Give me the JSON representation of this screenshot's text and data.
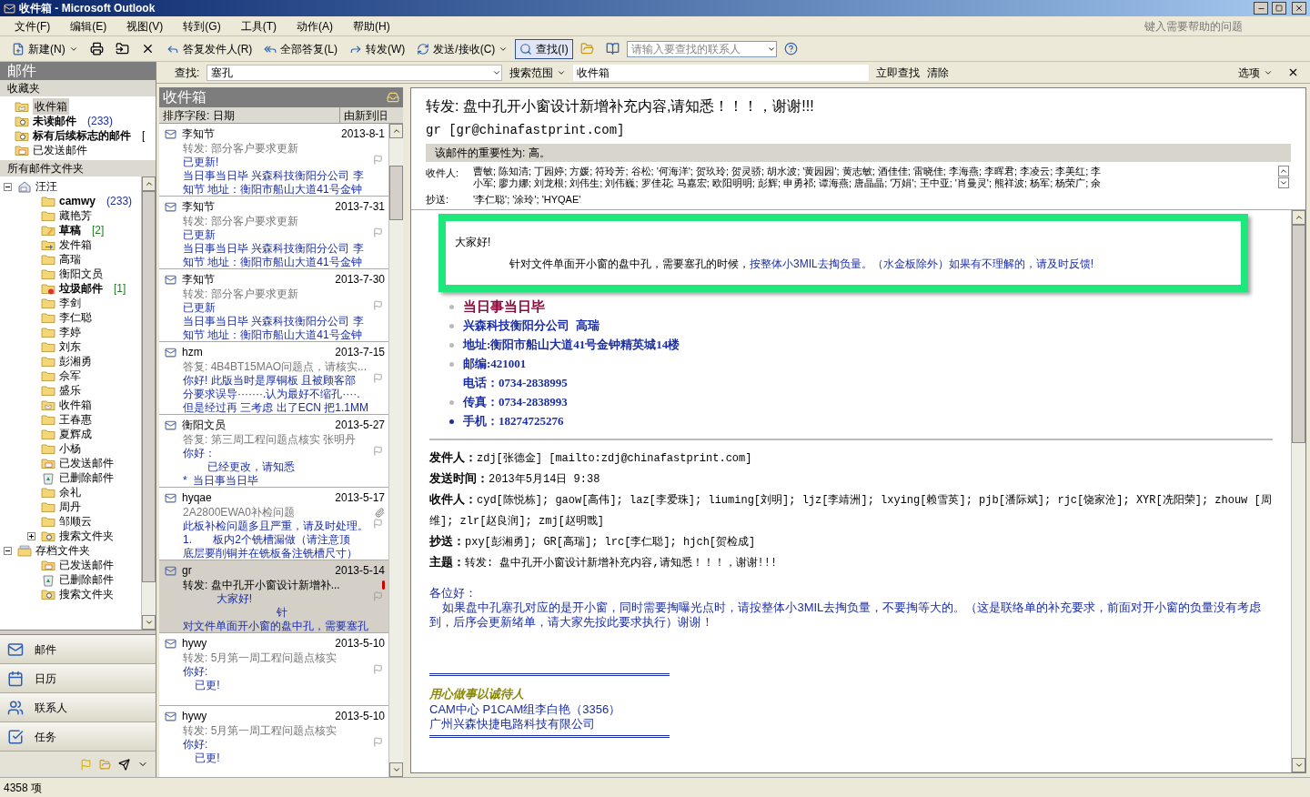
{
  "window": {
    "title": "收件箱 - Microsoft Outlook"
  },
  "menu": [
    "文件(F)",
    "编辑(E)",
    "视图(V)",
    "转到(G)",
    "工具(T)",
    "动作(A)",
    "帮助(H)"
  ],
  "help_box": {
    "placeholder": "键入需要帮助的问题"
  },
  "toolbar": [
    {
      "label": "新建(N)",
      "selected": false
    },
    {
      "label": "答复发件人(R)",
      "selected": false
    },
    {
      "label": "全部答复(L)",
      "selected": false
    },
    {
      "label": "转发(W)",
      "selected": false
    },
    {
      "label": "发送/接收(C)",
      "selected": false
    },
    {
      "label": "查找(I)",
      "selected": true
    }
  ],
  "contact_search": {
    "placeholder": "请输入要查找的联系人"
  },
  "navigation_title": "邮件",
  "find_bar": {
    "label": "查找:",
    "value": "塞孔",
    "scope_button": "搜索范围",
    "scope_value": "收件箱",
    "find_now": "立即查找",
    "clear": "清除",
    "options": "选项"
  },
  "favorites": {
    "title": "收藏夹",
    "items": [
      {
        "name": "收件箱",
        "kind": "inbox",
        "bold": false,
        "selected": true
      },
      {
        "name": "未读邮件",
        "kind": "search",
        "bold": true,
        "count": "(233)",
        "color": "#1b2ea6",
        "selected": false
      },
      {
        "name": "标有后续标志的邮件",
        "kind": "search",
        "bold": true,
        "count": "[",
        "selected": false
      },
      {
        "name": "已发送邮件",
        "kind": "sent",
        "bold": false,
        "selected": false
      }
    ]
  },
  "all_folders": {
    "title": "所有邮件文件夹",
    "tree": [
      {
        "name": "汪汪",
        "kind": "home",
        "bold": false,
        "expanded": true,
        "children": [
          {
            "name": "camwy",
            "kind": "folder",
            "bold": true,
            "count": "(233)",
            "color": "#1b2ea6"
          },
          {
            "name": "藏艳芳",
            "kind": "folder",
            "bold": false
          },
          {
            "name": "草稿",
            "kind": "drafts",
            "bold": true,
            "count": "[2]",
            "color": "#1d7a1d"
          },
          {
            "name": "发件箱",
            "kind": "outbox",
            "bold": false
          },
          {
            "name": "高瑞",
            "kind": "folder",
            "bold": false
          },
          {
            "name": "衡阳文员",
            "kind": "folder",
            "bold": false
          },
          {
            "name": "垃圾邮件",
            "kind": "junk",
            "bold": true,
            "count": "[1]",
            "color": "#1d7a1d"
          },
          {
            "name": "李剑",
            "kind": "folder",
            "bold": false
          },
          {
            "name": "李仁聪",
            "kind": "folder",
            "bold": false
          },
          {
            "name": "李婷",
            "kind": "folder",
            "bold": false
          },
          {
            "name": "刘东",
            "kind": "folder",
            "bold": false
          },
          {
            "name": "彭湘勇",
            "kind": "folder",
            "bold": false
          },
          {
            "name": "佘军",
            "kind": "folder",
            "bold": false
          },
          {
            "name": "盛乐",
            "kind": "folder",
            "bold": false
          },
          {
            "name": "收件箱",
            "kind": "inbox",
            "bold": false
          },
          {
            "name": "王春惠",
            "kind": "folder",
            "bold": false
          },
          {
            "name": "夏辉成",
            "kind": "folder",
            "bold": false
          },
          {
            "name": "小杨",
            "kind": "folder",
            "bold": false
          },
          {
            "name": "已发送邮件",
            "kind": "sent",
            "bold": false
          },
          {
            "name": "已删除邮件",
            "kind": "deleted",
            "bold": false
          },
          {
            "name": "余礼",
            "kind": "folder",
            "bold": false
          },
          {
            "name": "周丹",
            "kind": "folder",
            "bold": false
          },
          {
            "name": "邹顺云",
            "kind": "folder",
            "bold": false
          },
          {
            "name": "搜索文件夹",
            "kind": "search",
            "bold": false,
            "expanded": false
          }
        ]
      },
      {
        "name": "存档文件夹",
        "kind": "archive",
        "bold": false,
        "expanded": true,
        "children": [
          {
            "name": "已发送邮件",
            "kind": "sent",
            "bold": false
          },
          {
            "name": "已删除邮件",
            "kind": "deleted",
            "bold": false
          },
          {
            "name": "搜索文件夹",
            "kind": "search",
            "bold": false
          }
        ]
      }
    ]
  },
  "nav_buttons": [
    "邮件",
    "日历",
    "联系人",
    "任务"
  ],
  "message_list": {
    "title": "收件箱",
    "sort_label": "排序字段: 日期",
    "sort_order": "由新到旧",
    "messages": [
      {
        "sender": "李知节",
        "date": "2013-8-1",
        "subject": "转发: 部分客户要求更新",
        "preview": [
          "已更新!",
          "当日事当日毕 兴森科技衡阳分公司 李",
          "知节 地址：衡阳市船山大道41号金钟"
        ],
        "selected": false,
        "attachment": false,
        "important": false
      },
      {
        "sender": "李知节",
        "date": "2013-7-31",
        "subject": "转发: 部分客户要求更新",
        "preview": [
          "已更新",
          "当日事当日毕 兴森科技衡阳分公司 李",
          "知节 地址：衡阳市船山大道41号金钟"
        ],
        "selected": false,
        "attachment": false,
        "important": false
      },
      {
        "sender": "李知节",
        "date": "2013-7-30",
        "subject": "转发: 部分客户要求更新",
        "preview": [
          "已更新",
          "当日事当日毕 兴森科技衡阳分公司 李",
          "知节 地址：衡阳市船山大道41号金钟"
        ],
        "selected": false,
        "attachment": false,
        "important": false
      },
      {
        "sender": "hzm",
        "date": "2013-7-15",
        "subject": "答复: 4B4BT15MAO问题点，请核实...",
        "preview": [
          "你好! 此版当时是厚铜板 且被顾客部",
          "分要求误导·······.认为最好不缩孔····.",
          "但是经过再 三考虑 出了ECN 把1.1MM"
        ],
        "selected": false,
        "attachment": false,
        "important": false
      },
      {
        "sender": "衡阳文员",
        "date": "2013-5-27",
        "subject": "答复: 第三周工程问题点核实 张明丹",
        "preview": [
          "你好：",
          "        已经更改，请知悉",
          "*  当日事当日毕"
        ],
        "selected": false,
        "attachment": false,
        "important": false
      },
      {
        "sender": "hyqae",
        "date": "2013-5-17",
        "subject": "2A2800EWA0补检问题",
        "preview": [
          "此板补检问题多且严重，请及时处理。",
          "1.       板内2个铣槽漏做（请注意顶",
          "底层要削铜并在铣板备注铣槽尺寸）"
        ],
        "selected": false,
        "attachment": true,
        "important": false
      },
      {
        "sender": "gr",
        "date": "2013-5-14",
        "subject": "转发: 盘中孔开小窗设计新增补...",
        "preview": [
          "           大家好!",
          "                               针",
          "对文件单面开小窗的盘中孔，需要塞孔"
        ],
        "selected": true,
        "attachment": false,
        "important": true
      },
      {
        "sender": "hywy",
        "date": "2013-5-10",
        "subject": "转发: 5月第一周工程问题点核实",
        "preview": [
          "你好:",
          "    已更!"
        ],
        "selected": false,
        "attachment": false,
        "important": false
      },
      {
        "sender": "hywy",
        "date": "2013-5-10",
        "subject": "转发: 5月第一周工程问题点核实",
        "preview": [
          "你好:",
          "    已更!"
        ],
        "selected": false,
        "attachment": false,
        "important": false
      }
    ]
  },
  "reading_pane": {
    "subject": "转发: 盘中孔开小窗设计新增补充内容,请知悉！！！，谢谢!!!",
    "from": "gr [gr@chinafastprint.com]",
    "importance": "该邮件的重要性为: 高。",
    "to_label": "收件人:",
    "to_lines": [
      "曹敏; 陈知清; 丁园婷; 方媛; 符玲芳; 谷松; '何海洋'; 贺玖玲; 贺灵骄; 胡水波; '黄园园'; 黄志敏; 酒佳佳; 雷晓佳; 李海燕; 李晖君; 李凌云; 李美红; 李",
      "小军; 廖力娜; 刘龙根; 刘伟生; 刘伟巍; 罗佳花; 马嘉宏; 欧阳明明; 彭辉; 申勇祁; 谭海燕; 唐晶晶; '万娟'; 王中亚; '肖曼灵'; 熊祥波; 杨军; 杨荣广; 余"
    ],
    "cc_label": "抄送:",
    "cc": "'李仁聪'; '涂玲'; 'HYQAE'",
    "popup": {
      "greeting": "大家好!",
      "text_plain": "针对文件单面开小窗的盘中孔，需要塞孔的时候，",
      "text_highlight": "按整体小3MIL去掏负量。（水金板除外）如果有不理解的，请及时反馈!"
    },
    "signature_list": [
      {
        "text": "当日事当日毕",
        "bullet": true,
        "kind": "motto"
      },
      {
        "text": "兴森科技衡阳分公司  高瑞",
        "bullet": true,
        "kind": "info"
      },
      {
        "text": "地址:衡阳市船山大道41号金钟精英城14楼",
        "bullet": true,
        "kind": "info"
      },
      {
        "text": "邮编:421001",
        "bullet": true,
        "kind": "info"
      },
      {
        "text": "电话：0734-2838995",
        "bullet": false,
        "kind": "info"
      },
      {
        "text": "传真：0734-2838993",
        "bullet": true,
        "kind": "info"
      },
      {
        "text": "手机：18274725276",
        "bullet": true,
        "kind": "info"
      }
    ],
    "forward_header": [
      {
        "label": "发件人：",
        "value": "zdj[张德金] [mailto:zdj@chinafastprint.com]"
      },
      {
        "label": "发送时间：",
        "value": "2013年5月14日 9:38"
      },
      {
        "label": "收件人：",
        "value": "cyd[陈悦栋]; gaow[高伟]; laz[李爱珠]; liuming[刘明]; ljz[李靖洲]; lxying[赖雪英]; pjb[潘际斌]; rjc[饶家沧]; XYR[冼阳荣]; zhouw [周维]; zlr[赵良润]; zmj[赵明戬]"
      },
      {
        "label": "抄送：",
        "value": "pxy[彭湘勇]; GR[高瑞]; lrc[李仁聪]; hjch[贺检成]"
      },
      {
        "label": "主题：",
        "value": "转发: 盘中孔开小窗设计新增补充内容,请知悉！！！，谢谢!!!"
      }
    ],
    "body": {
      "greeting": "各位好：",
      "paragraph": "    如果盘中孔塞孔对应的是开小窗，同时需要掏曝光点时，请按整体小3MIL去掏负量，不要掏等大的。（这是联络单的补充要求，前面对开小窗的负量没有考虑到，后序会更新绪单，请大家先按此要求执行）谢谢！"
    },
    "signature": {
      "slogan": "用心做事以诚待人",
      "lines": [
        "CAM中心 P1CAM组李白艳（3356）",
        "广州兴森快捷电路科技有限公司"
      ]
    }
  },
  "status_bar": "4358 项"
}
